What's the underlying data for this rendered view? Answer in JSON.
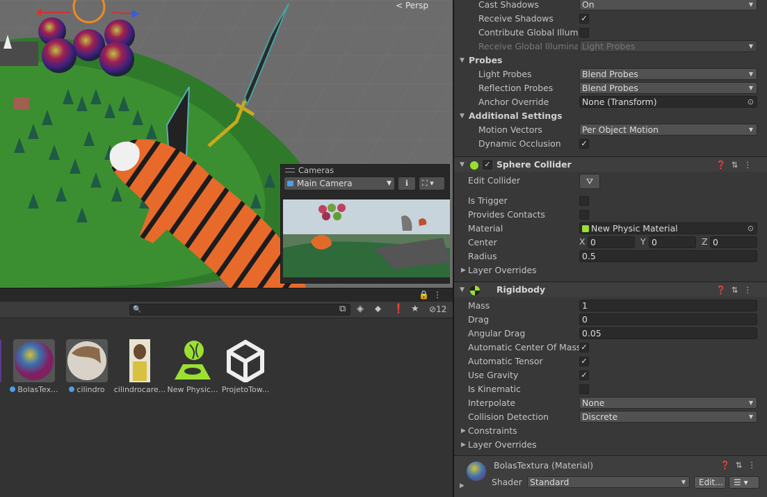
{
  "scene": {
    "persp_label": "< Persp"
  },
  "camera_preview": {
    "title": "Cameras",
    "camera": "Main Camera"
  },
  "project": {
    "hidden_count": "12",
    "assets": [
      {
        "label": "BolasTex...",
        "has_icon": true
      },
      {
        "label": "cilindro",
        "has_icon": true
      },
      {
        "label": "cilindrocare...",
        "has_icon": false
      },
      {
        "label": "New Physic...",
        "has_icon": false
      },
      {
        "label": "ProjetoTow...",
        "has_icon": false
      }
    ]
  },
  "inspector": {
    "renderer": {
      "cast_shadows": {
        "label": "Cast Shadows",
        "value": "On"
      },
      "receive_shadows": {
        "label": "Receive Shadows",
        "checked": true
      },
      "contribute_gi": {
        "label": "Contribute Global Illumination",
        "checked": false
      },
      "receive_gi": {
        "label": "Receive Global Illumination",
        "value": "Light Probes"
      }
    },
    "probes": {
      "title": "Probes",
      "light_probes": {
        "label": "Light Probes",
        "value": "Blend Probes"
      },
      "reflection_probes": {
        "label": "Reflection Probes",
        "value": "Blend Probes"
      },
      "anchor_override": {
        "label": "Anchor Override",
        "value": "None (Transform)"
      }
    },
    "additional": {
      "title": "Additional Settings",
      "motion_vectors": {
        "label": "Motion Vectors",
        "value": "Per Object Motion"
      },
      "dynamic_occlusion": {
        "label": "Dynamic Occlusion",
        "checked": true
      }
    },
    "sphere_collider": {
      "title": "Sphere Collider",
      "edit_collider": "Edit Collider",
      "is_trigger": {
        "label": "Is Trigger",
        "checked": false
      },
      "provides_contacts": {
        "label": "Provides Contacts",
        "checked": false
      },
      "material": {
        "label": "Material",
        "value": "New Physic Material"
      },
      "center": {
        "label": "Center",
        "x": "0",
        "y": "0",
        "z": "0"
      },
      "radius": {
        "label": "Radius",
        "value": "0.5"
      },
      "layer_overrides": "Layer Overrides"
    },
    "rigidbody": {
      "title": "Rigidbody",
      "mass": {
        "label": "Mass",
        "value": "1"
      },
      "drag": {
        "label": "Drag",
        "value": "0"
      },
      "angular_drag": {
        "label": "Angular Drag",
        "value": "0.05"
      },
      "auto_com": {
        "label": "Automatic Center Of Mass",
        "checked": true
      },
      "auto_tensor": {
        "label": "Automatic Tensor",
        "checked": true
      },
      "use_gravity": {
        "label": "Use Gravity",
        "checked": true
      },
      "is_kinematic": {
        "label": "Is Kinematic",
        "checked": false
      },
      "interpolate": {
        "label": "Interpolate",
        "value": "None"
      },
      "collision_detection": {
        "label": "Collision Detection",
        "value": "Discrete"
      },
      "constraints": "Constraints",
      "layer_overrides": "Layer Overrides"
    },
    "material": {
      "title": "BolasTextura (Material)",
      "shader_label": "Shader",
      "shader": "Standard",
      "edit": "Edit..."
    }
  }
}
